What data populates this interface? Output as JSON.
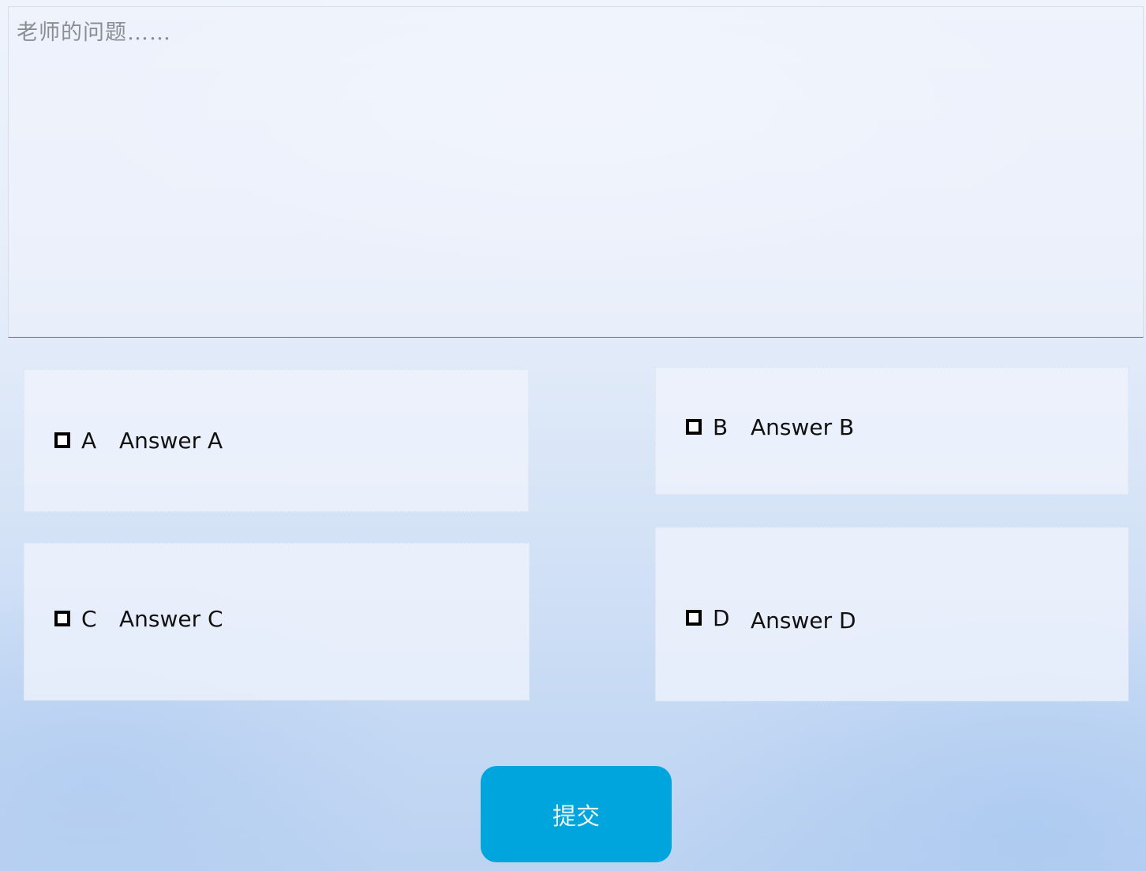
{
  "question": {
    "text": "老师的问题……"
  },
  "options": [
    {
      "letter": "A",
      "answer": "Answer A"
    },
    {
      "letter": "B",
      "answer": "Answer B"
    },
    {
      "letter": "C",
      "answer": "Answer C"
    },
    {
      "letter": "D",
      "answer": "Answer D"
    }
  ],
  "submit": {
    "label": "提交"
  },
  "colors": {
    "submit_button": "#00a5de",
    "question_text": "#8a8d92",
    "checkbox_border": "#000000"
  }
}
